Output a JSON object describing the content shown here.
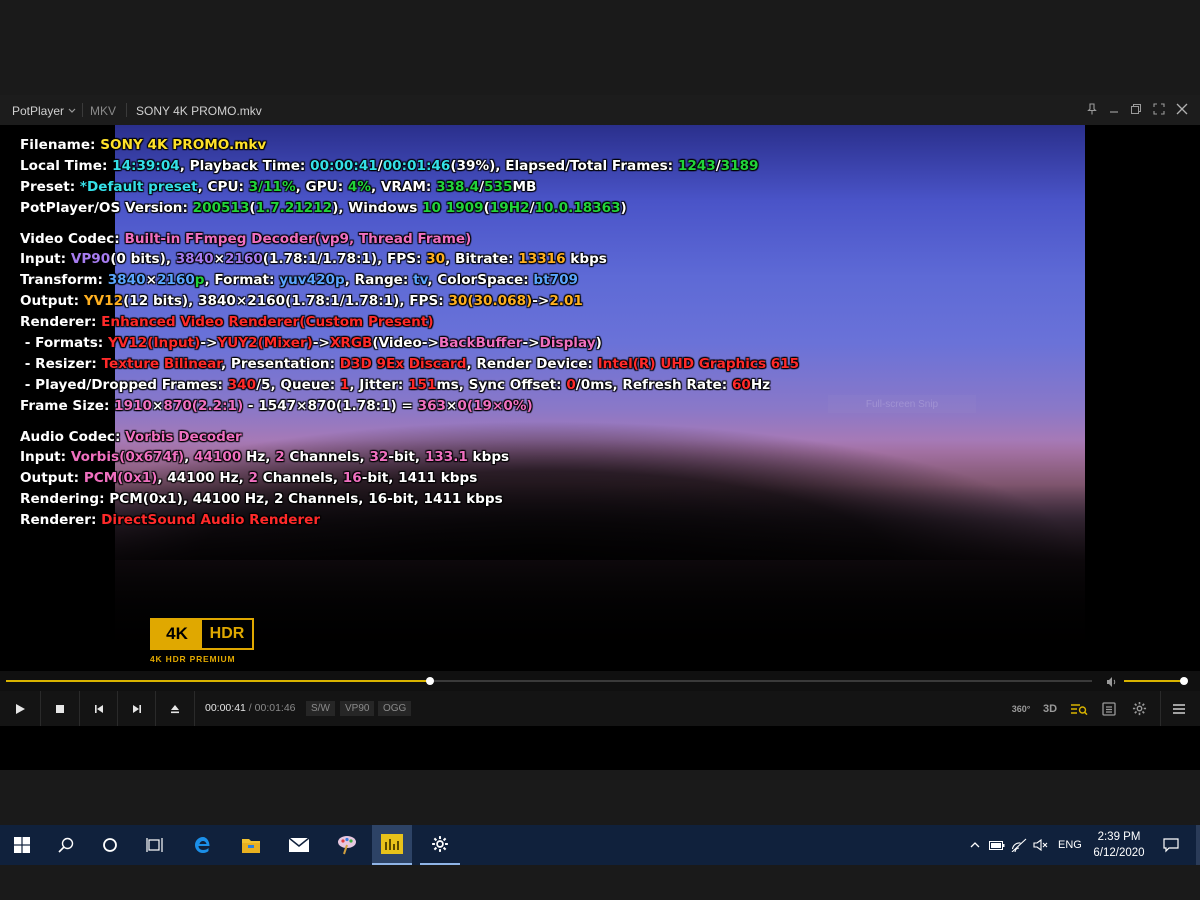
{
  "titlebar": {
    "app_name": "PotPlayer",
    "format": "MKV",
    "file_title": "SONY 4K PROMO.mkv"
  },
  "video_overlay": {
    "snip_hint": "Full-screen Snip"
  },
  "osd": {
    "filename": {
      "label": "Filename: ",
      "value": "SONY 4K PROMO.mkv"
    },
    "local_time": {
      "label": "Local Time: ",
      "time": "14:39:04",
      "pb_label": ", Playback Time: ",
      "pb": "00:00:41",
      "slash": "/",
      "total": "00:01:46",
      "pct": "(39%)",
      "frames_label": ", Elapsed/Total Frames: ",
      "frames": "1243",
      "slash2": "/",
      "total_frames": "3189"
    },
    "preset": {
      "label": "Preset: ",
      "value": "*Default preset",
      "cpu_label": ", CPU: ",
      "cpu": "3",
      "cpu_total": "/11%",
      "gpu_label": ", GPU: ",
      "gpu": "4%",
      "vram_label": ", VRAM: ",
      "vram": "338.4",
      "vram_sep": "/",
      "vram_total": "535",
      "vram_unit": "MB"
    },
    "version": {
      "label": "PotPlayer/OS Version: ",
      "build": "200513",
      "p1": "(",
      "ver": "1.7.21212",
      "p2": "), Windows ",
      "win": "10 1909",
      "p3": "(",
      "h2": "19H2",
      "p4": "/",
      "os": "10.0.18363",
      "p5": ")"
    },
    "video_codec": {
      "label": "Video Codec: ",
      "value": "Built-in FFmpeg Decoder(vp9, Thread Frame)"
    },
    "input": {
      "label": "Input: ",
      "codec": "VP90",
      "bits": "(0 bits), ",
      "w": "3840",
      "x": "×",
      "h": "2160",
      "ar": "(1.78:1/1.78:1)",
      "fps_label": ", FPS: ",
      "fps": "30",
      "br_label": ", Bitrate: ",
      "br": "13316",
      "br_unit": " kbps"
    },
    "transform": {
      "label": "Transform: ",
      "w": "3840",
      "x": "×",
      "h": "2160",
      "p": "p",
      "fmt_label": ", Format: ",
      "fmt": "yuv420p",
      "range_label": ", Range: ",
      "range": "tv",
      "cs_label": ", ColorSpace: ",
      "cs": "bt709"
    },
    "output": {
      "label": "Output: ",
      "fmt": "YV12",
      "bits": "(12 bits), 3840×2160(1.78:1/1.78:1), FPS: ",
      "fps": "30",
      "fps2": "(30.068)",
      "arrow": "->",
      "ratio": "2.01"
    },
    "renderer": {
      "label": "Renderer: ",
      "value": "Enhanced Video Renderer(Custom Present)"
    },
    "formats": {
      "label": " - Formats: ",
      "f1": "YV12",
      "f1b": "(Input)",
      "a1": "->",
      "f2": "YUY2",
      "f2b": "(Mixer)",
      "a2": "->",
      "f3": "XRGB",
      "f3b": "(Video->",
      "f4": "BackBuffer",
      "a3": "->",
      "f5": "Display",
      "end": ")"
    },
    "resizer": {
      "label": " - Resizer: ",
      "value": "Texture Bilinear",
      "pres_label": ", Presentation: ",
      "pres": "D3D 9Ex Discard",
      "dev_label": ", Render Device: ",
      "dev": "Intel(R) UHD Graphics 615"
    },
    "played": {
      "label": " - Played/Dropped Frames: ",
      "played": "340",
      "dropped": "/5",
      "q_label": ", Queue: ",
      "q": "1",
      "j_label": ", Jitter: ",
      "j": "151",
      "j_unit": "ms, Sync Offset: ",
      "so": "0",
      "so2": "/0",
      "so_unit": "ms, Refresh Rate: ",
      "rr": "60",
      "rr_unit": "Hz"
    },
    "frame_size": {
      "label": "Frame Size: ",
      "w": "1910",
      "x": "×",
      "h": "870",
      "ar": "(2.2:1)",
      "mid": " - 1547×870(1.78:1) = ",
      "dw": "363",
      "x2": "×",
      "dh": "0",
      "pct": "(19×0%)"
    },
    "audio_codec": {
      "label": "Audio Codec: ",
      "value": "Vorbis Decoder"
    },
    "a_input": {
      "label": "Input: ",
      "codec": "Vorbis",
      "tag": "(0x674f)",
      "hz_label": ", ",
      "hz": "44100",
      "hz_unit": " Hz, ",
      "ch": "2",
      "ch_unit": " Channels, ",
      "bit": "32",
      "bit_unit": "-bit, ",
      "kb": "133.1",
      "kb_unit": " kbps"
    },
    "a_output": {
      "label": "Output: ",
      "codec": "PCM",
      "tag": "(0x1)",
      "rest1": ", 44100 Hz, ",
      "ch": "2",
      "ch_unit": " Channels, ",
      "bit": "16",
      "bit_unit": "-bit, 1411 kbps"
    },
    "a_rendering": {
      "label": "Rendering: ",
      "value": "PCM(0x1), 44100 Hz, 2 Channels, 16-bit, 1411 kbps"
    },
    "a_renderer": {
      "label": "Renderer: ",
      "value": "DirectSound Audio Renderer"
    }
  },
  "logo": {
    "k4": "4K",
    "hdr": "HDR",
    "sub": "4K HDR PREMIUM"
  },
  "playback": {
    "progress": 0.39,
    "volume": 1.0,
    "current_time": "00:00:41",
    "separator": "/",
    "total_time": "00:01:46",
    "tags": [
      "S/W",
      "VP90",
      "OGG"
    ],
    "btn_360": "360°",
    "btn_3d": "3D"
  },
  "taskbar": {
    "time": "2:39 PM",
    "date": "6/12/2020",
    "lang": "ENG"
  },
  "colors": {
    "accent": "#d9b400",
    "taskbar": "#10213c"
  }
}
